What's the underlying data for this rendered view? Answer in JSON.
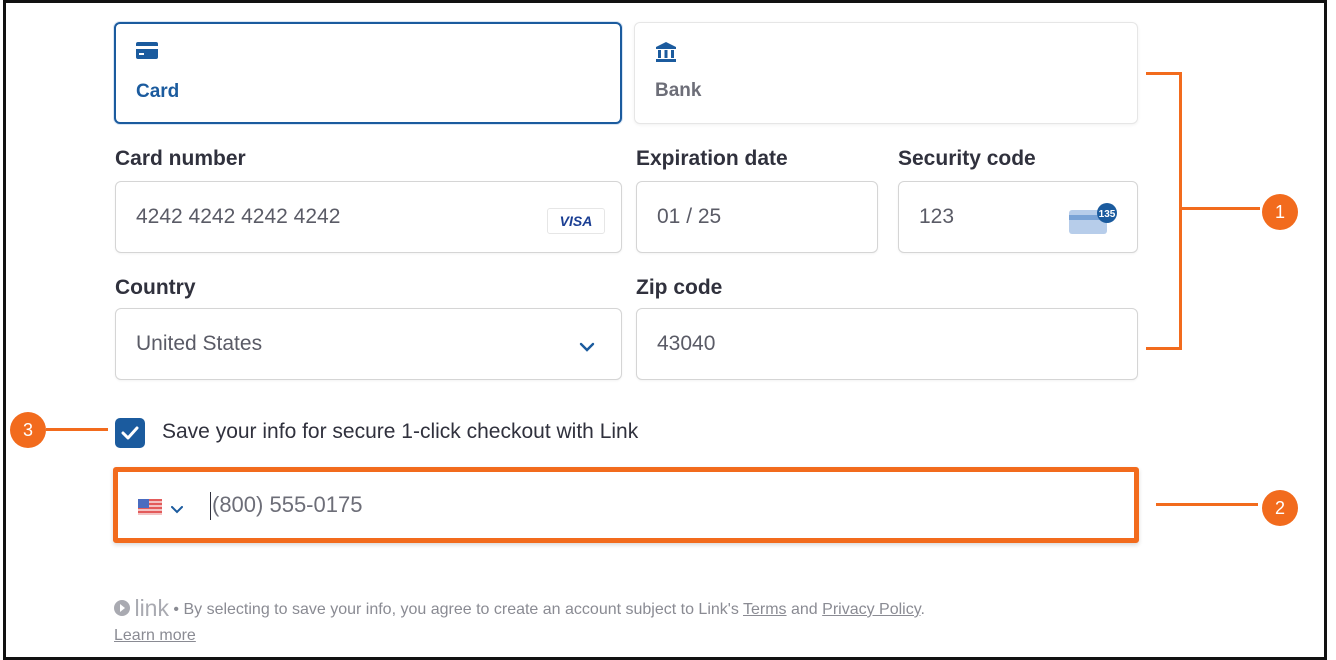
{
  "tabs": {
    "card": {
      "label": "Card",
      "icon": "credit-card-icon",
      "selected": true
    },
    "bank": {
      "label": "Bank",
      "icon": "bank-icon",
      "selected": false
    }
  },
  "form": {
    "card_number": {
      "label": "Card number",
      "value": "4242 4242 4242 4242",
      "brand": "VISA"
    },
    "expiration": {
      "label": "Expiration date",
      "value": "01 / 25"
    },
    "security_code": {
      "label": "Security code",
      "value": "123",
      "icon_text": "135"
    },
    "country": {
      "label": "Country",
      "value": "United States"
    },
    "zip": {
      "label": "Zip code",
      "value": "43040"
    }
  },
  "save_info": {
    "checked": true,
    "label": "Save your info for secure 1-click checkout with Link"
  },
  "phone": {
    "country_flag": "us-flag-icon",
    "value": "(800) 555-0175"
  },
  "legal": {
    "brand": "link",
    "text_before_terms": " • By selecting to save your info, you agree to create an account subject to Link's ",
    "terms": "Terms",
    "and": " and ",
    "privacy": "Privacy Policy",
    "period": ".",
    "learn_more": "Learn more"
  },
  "annotations": {
    "one": "1",
    "two": "2",
    "three": "3"
  },
  "colors": {
    "accent": "#1b5b9e",
    "annotation": "#f26b1d"
  }
}
